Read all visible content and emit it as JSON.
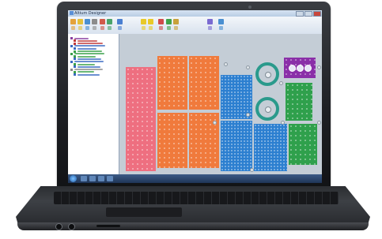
{
  "app": {
    "title": "Altium Designer",
    "icon_name": "app-icon",
    "window_buttons": [
      "minimize-icon",
      "maximize-icon",
      "close-icon"
    ]
  },
  "toolbar": {
    "tools": [
      {
        "icon": "file-icon",
        "color": "#e4a23b"
      },
      {
        "icon": "open-icon",
        "color": "#e4c13b"
      },
      {
        "icon": "save-icon",
        "color": "#4a8fd1"
      },
      {
        "icon": "print-icon",
        "color": "#8c8c8c"
      },
      {
        "icon": "undo-icon",
        "color": "#d15a4a"
      },
      {
        "icon": "redo-icon",
        "color": "#4aa36a"
      },
      {
        "icon": "zoom-icon",
        "color": "#4a7fd1"
      },
      {
        "icon": "route-icon",
        "color": "#e8c928"
      },
      {
        "icon": "layer-icon",
        "color": "#e8c928"
      },
      {
        "icon": "drc-icon",
        "color": "#d14a4a"
      },
      {
        "icon": "board-icon",
        "color": "#3fa34a"
      },
      {
        "icon": "component-icon",
        "color": "#c8a23b"
      },
      {
        "icon": "3d-icon",
        "color": "#7a6ad1"
      },
      {
        "icon": "help-icon",
        "color": "#4a8fd1"
      }
    ]
  },
  "panel": {
    "items": [
      {
        "color": "#8a3fa0"
      },
      {
        "color": "#c23a3a"
      },
      {
        "color": "#c23a3a"
      },
      {
        "color": "#3a6ac2"
      },
      {
        "color": "#3a6ac2"
      },
      {
        "color": "#3aa04a"
      },
      {
        "color": "#3aa04a"
      },
      {
        "color": "#3aa04a"
      },
      {
        "color": "#3a6ac2"
      },
      {
        "color": "#3a6ac2"
      },
      {
        "color": "#3aa04a"
      },
      {
        "color": "#3a6ac2"
      },
      {
        "color": "#8a8a8a"
      },
      {
        "color": "#3aa04a"
      },
      {
        "color": "#3a6ac2"
      }
    ]
  },
  "canvas": {
    "boards": [
      {
        "name": "pink-board",
        "color": "#ee6f80"
      },
      {
        "name": "orange-board-1",
        "color": "#f07a3c"
      },
      {
        "name": "orange-board-2",
        "color": "#f07a3c"
      },
      {
        "name": "orange-board-3",
        "color": "#f07a3c"
      },
      {
        "name": "orange-board-4",
        "color": "#f07a3c"
      },
      {
        "name": "blue-board-1",
        "color": "#2c7fd0"
      },
      {
        "name": "blue-board-2",
        "color": "#2c7fd0"
      },
      {
        "name": "blue-board-3",
        "color": "#2c7fd0"
      },
      {
        "name": "green-board-1",
        "color": "#2fa04c"
      },
      {
        "name": "green-board-2",
        "color": "#2fa04c"
      },
      {
        "name": "purple-board",
        "color": "#8a2fa8"
      }
    ],
    "ring_color": "#2a9a8c"
  },
  "taskbar": {
    "start_icon": "start-orb-icon",
    "items": [
      "explorer-icon",
      "browser-icon",
      "media-icon",
      "altium-icon"
    ],
    "clock": ""
  }
}
